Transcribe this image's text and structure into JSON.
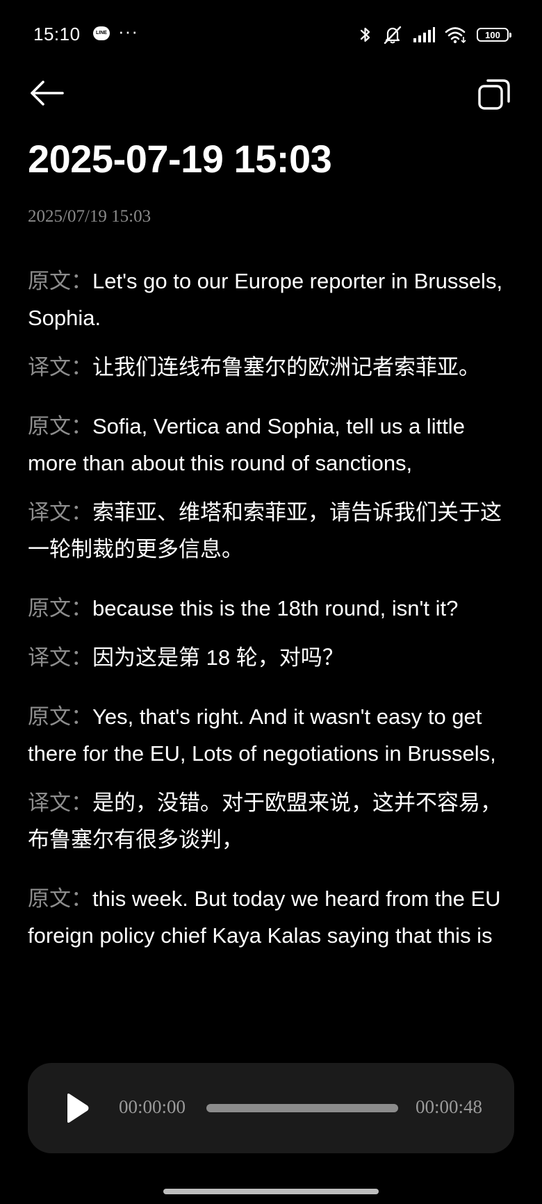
{
  "status_bar": {
    "time": "15:10",
    "line_badge": "LINE",
    "dots": "···",
    "battery": "100",
    "icons": [
      "bluetooth-icon",
      "mute-icon",
      "signal-icon",
      "wifi-icon",
      "battery-icon"
    ]
  },
  "header": {
    "back_icon": "arrow-left-icon",
    "copy_icon": "copy-icon",
    "title": "2025-07-19 15:03",
    "subtitle": "2025/07/19 15:03"
  },
  "transcript": [
    {
      "original_label": "原文：",
      "original": "Let's go to our Europe reporter in Brussels, Sophia.",
      "translation_label": "译文：",
      "translation": "让我们连线布鲁塞尔的欧洲记者索菲亚。"
    },
    {
      "original_label": "原文：",
      "original": "Sofia, Vertica and Sophia, tell us a little more than about this round of sanctions,",
      "translation_label": "译文：",
      "translation": "索菲亚、维塔和索菲亚，请告诉我们关于这一轮制裁的更多信息。"
    },
    {
      "original_label": "原文：",
      "original": "because this is the 18th round, isn't it?",
      "translation_label": "译文：",
      "translation": "因为这是第 18 轮，对吗？"
    },
    {
      "original_label": "原文：",
      "original": "Yes, that's right. And it wasn't easy to get there for the EU, Lots of negotiations in Brussels,",
      "translation_label": "译文：",
      "translation": "是的，没错。对于欧盟来说，这并不容易，布鲁塞尔有很多谈判，"
    },
    {
      "original_label": "原文：",
      "original": "this week. But today we heard from the EU foreign policy chief Kaya Kalas saying that this is"
    }
  ],
  "player": {
    "play_icon": "play-icon",
    "current_time": "00:00:00",
    "total_time": "00:00:48",
    "progress": 0
  },
  "colors": {
    "background": "#000000",
    "label": "#8d8d8d",
    "player_bg": "#1b1b1b"
  }
}
